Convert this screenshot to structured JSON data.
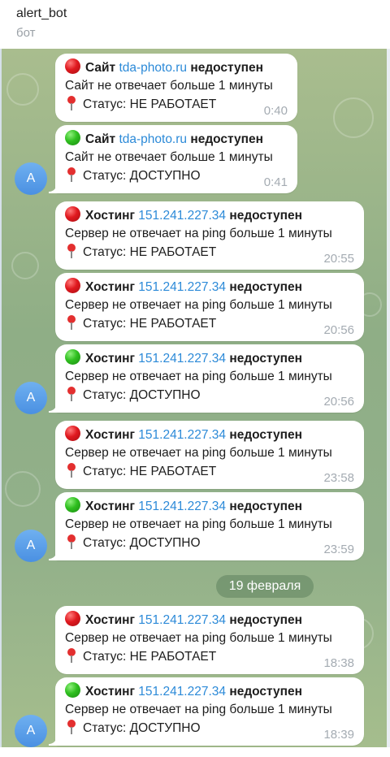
{
  "header": {
    "title": "alert_bot",
    "subtitle": "бот"
  },
  "avatar_letter": "A",
  "date_separator": "19 февраля",
  "messages": [
    {
      "kind": "site",
      "status_color": "red",
      "prefix": "Сайт",
      "target": "tda-photo.ru",
      "suffix": "недоступен",
      "body": "Сайт не отвечает больше 1 минуты",
      "status": "Статус: НЕ РАБОТАЕТ",
      "time": "0:40"
    },
    {
      "kind": "site",
      "status_color": "green",
      "prefix": "Сайт",
      "target": "tda-photo.ru",
      "suffix": "недоступен",
      "body": "Сайт не отвечает больше 1 минуты",
      "status": "Статус: ДОСТУПНО",
      "time": "0:41"
    },
    {
      "kind": "host",
      "status_color": "red",
      "prefix": "Хостинг",
      "target": "151.241.227.34",
      "suffix": "недоступен",
      "body": "Сервер не отвечает на ping больше 1 минуты",
      "status": "Статус: НЕ РАБОТАЕТ",
      "time": "20:55"
    },
    {
      "kind": "host",
      "status_color": "red",
      "prefix": "Хостинг",
      "target": "151.241.227.34",
      "suffix": "недоступен",
      "body": "Сервер не отвечает на ping больше 1 минуты",
      "status": "Статус: НЕ РАБОТАЕТ",
      "time": "20:56"
    },
    {
      "kind": "host",
      "status_color": "green",
      "prefix": "Хостинг",
      "target": "151.241.227.34",
      "suffix": "недоступен",
      "body": "Сервер не отвечает на ping больше 1 минуты",
      "status": "Статус: ДОСТУПНО",
      "time": "20:56"
    },
    {
      "kind": "host",
      "status_color": "red",
      "prefix": "Хостинг",
      "target": "151.241.227.34",
      "suffix": "недоступен",
      "body": "Сервер не отвечает на ping больше 1 минуты",
      "status": "Статус: НЕ РАБОТАЕТ",
      "time": "23:58"
    },
    {
      "kind": "host",
      "status_color": "green",
      "prefix": "Хостинг",
      "target": "151.241.227.34",
      "suffix": "недоступен",
      "body": "Сервер не отвечает на ping больше 1 минуты",
      "status": "Статус: ДОСТУПНО",
      "time": "23:59"
    },
    {
      "kind": "host",
      "status_color": "red",
      "prefix": "Хостинг",
      "target": "151.241.227.34",
      "suffix": "недоступен",
      "body": "Сервер не отвечает на ping больше 1 минуты",
      "status": "Статус: НЕ РАБОТАЕТ",
      "time": "18:38"
    },
    {
      "kind": "host",
      "status_color": "green",
      "prefix": "Хостинг",
      "target": "151.241.227.34",
      "suffix": "недоступен",
      "body": "Сервер не отвечает на ping больше 1 минуты",
      "status": "Статус: ДОСТУПНО",
      "time": "18:39"
    }
  ],
  "colors": {
    "link": "#2c8ad8",
    "red_dot": "#e0191f",
    "green_dot": "#2fbf1f",
    "avatar": "#4a90e2"
  }
}
